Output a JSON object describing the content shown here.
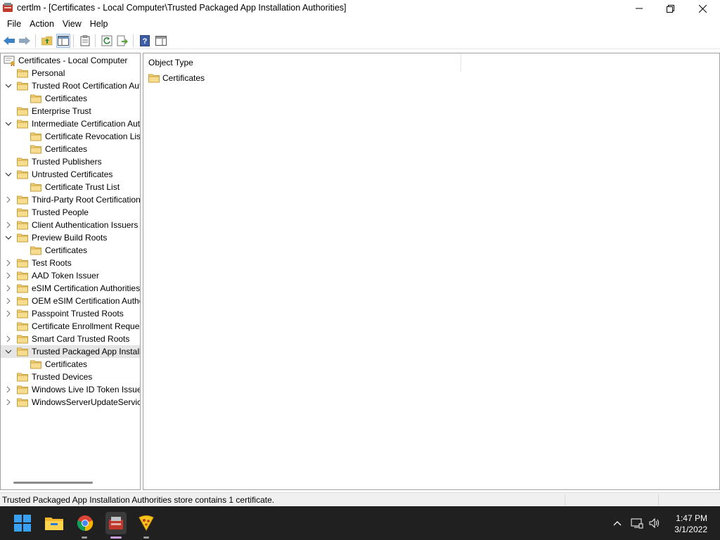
{
  "window": {
    "title": "certlm - [Certificates - Local Computer\\Trusted Packaged App Installation Authorities]"
  },
  "menu": [
    {
      "label": "File"
    },
    {
      "label": "Action"
    },
    {
      "label": "View"
    },
    {
      "label": "Help"
    }
  ],
  "toolbar": {
    "icons": [
      "back-arrow-icon",
      "forward-arrow-icon",
      "up-folder-icon",
      "show-hide-console-tree-icon",
      "properties-icon",
      "refresh-icon",
      "export-list-icon",
      "help-icon",
      "show-action-pane-icon"
    ]
  },
  "tree": {
    "root": "Certificates - Local Computer",
    "items": [
      {
        "label": "Personal",
        "level": 1,
        "expander": "none"
      },
      {
        "label": "Trusted Root Certification Authorities",
        "level": 1,
        "expander": "expanded"
      },
      {
        "label": "Certificates",
        "level": 2,
        "expander": "none"
      },
      {
        "label": "Enterprise Trust",
        "level": 1,
        "expander": "none"
      },
      {
        "label": "Intermediate Certification Authorities",
        "level": 1,
        "expander": "expanded"
      },
      {
        "label": "Certificate Revocation List",
        "level": 2,
        "expander": "none"
      },
      {
        "label": "Certificates",
        "level": 2,
        "expander": "none"
      },
      {
        "label": "Trusted Publishers",
        "level": 1,
        "expander": "none"
      },
      {
        "label": "Untrusted Certificates",
        "level": 1,
        "expander": "expanded"
      },
      {
        "label": "Certificate Trust List",
        "level": 2,
        "expander": "none"
      },
      {
        "label": "Third-Party Root Certification Authorities",
        "level": 1,
        "expander": "collapsed"
      },
      {
        "label": "Trusted People",
        "level": 1,
        "expander": "none"
      },
      {
        "label": "Client Authentication Issuers",
        "level": 1,
        "expander": "collapsed"
      },
      {
        "label": "Preview Build Roots",
        "level": 1,
        "expander": "expanded"
      },
      {
        "label": "Certificates",
        "level": 2,
        "expander": "none"
      },
      {
        "label": "Test Roots",
        "level": 1,
        "expander": "collapsed"
      },
      {
        "label": "AAD Token Issuer",
        "level": 1,
        "expander": "collapsed"
      },
      {
        "label": "eSIM Certification Authorities",
        "level": 1,
        "expander": "collapsed"
      },
      {
        "label": "OEM eSIM Certification Authorities",
        "level": 1,
        "expander": "collapsed"
      },
      {
        "label": "Passpoint Trusted Roots",
        "level": 1,
        "expander": "collapsed"
      },
      {
        "label": "Certificate Enrollment Requests",
        "level": 1,
        "expander": "none"
      },
      {
        "label": "Smart Card Trusted Roots",
        "level": 1,
        "expander": "collapsed"
      },
      {
        "label": "Trusted Packaged App Installation Authorities",
        "level": 1,
        "expander": "expanded",
        "selected": true
      },
      {
        "label": "Certificates",
        "level": 2,
        "expander": "none"
      },
      {
        "label": "Trusted Devices",
        "level": 1,
        "expander": "none"
      },
      {
        "label": "Windows Live ID Token Issuer",
        "level": 1,
        "expander": "collapsed"
      },
      {
        "label": "WindowsServerUpdateServices",
        "level": 1,
        "expander": "collapsed"
      }
    ]
  },
  "content": {
    "column_header": "Object Type",
    "items": [
      {
        "label": "Certificates"
      }
    ]
  },
  "status": {
    "text": "Trusted Packaged App Installation Authorities store contains 1 certificate."
  },
  "taskbar": {
    "apps": [
      "windows-start-icon",
      "file-explorer-icon",
      "chrome-icon",
      "certlm-app-icon",
      "pizza-app-icon"
    ],
    "clock": {
      "time": "1:47 PM",
      "date": "3/1/2022"
    }
  },
  "colors": {
    "folder": "#e8c55a",
    "selected_row": "#e5e5e5",
    "taskbar_bg": "#202020",
    "accent_blue": "#3c82c9"
  }
}
